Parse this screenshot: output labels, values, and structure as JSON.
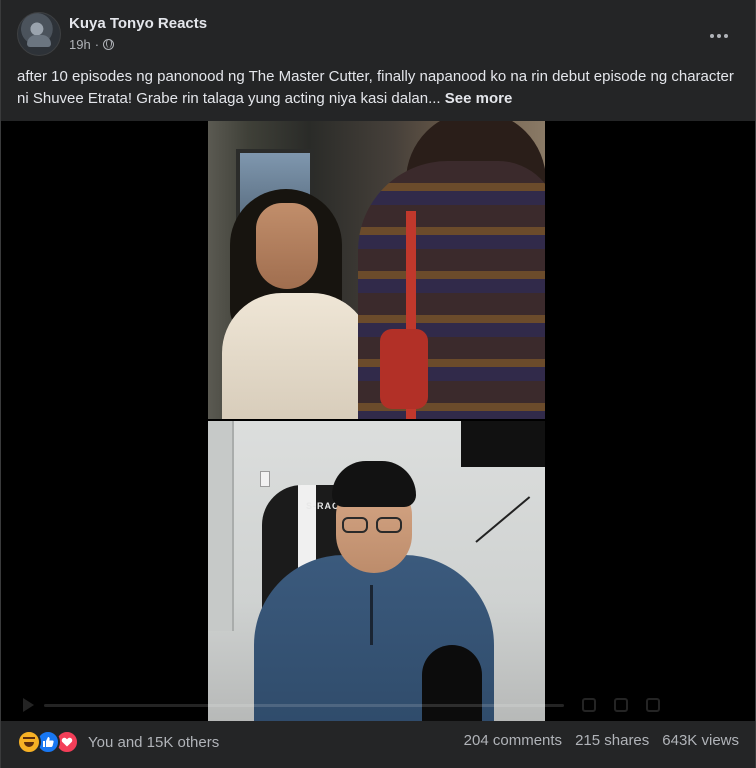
{
  "post": {
    "author": "Kuya Tonyo Reacts",
    "time": "19h",
    "audience_icon": "globe-icon",
    "caption": "after 10 episodes ng panonood ng The Master Cutter, finally napanood ko na rin debut episode ng character ni Shuvee Etrata! Grabe rin talaga yung acting niya kasi dalan...",
    "see_more": "See more",
    "more_icon": "more-options-icon"
  },
  "video": {
    "chair_brand": "S-RACE"
  },
  "engagement": {
    "reactions": [
      "haha-icon",
      "like-icon",
      "love-icon"
    ],
    "reaction_text": "You and 15K others",
    "comments": "204 comments",
    "shares": "215 shares",
    "views": "643K views"
  },
  "colors": {
    "card_bg": "#242526",
    "page_bg": "#18191a",
    "primary_text": "#e4e6eb",
    "secondary_text": "#b0b3b8",
    "like_blue": "#1877f2",
    "love_red": "#f33e58",
    "haha_yellow": "#f7b125"
  }
}
